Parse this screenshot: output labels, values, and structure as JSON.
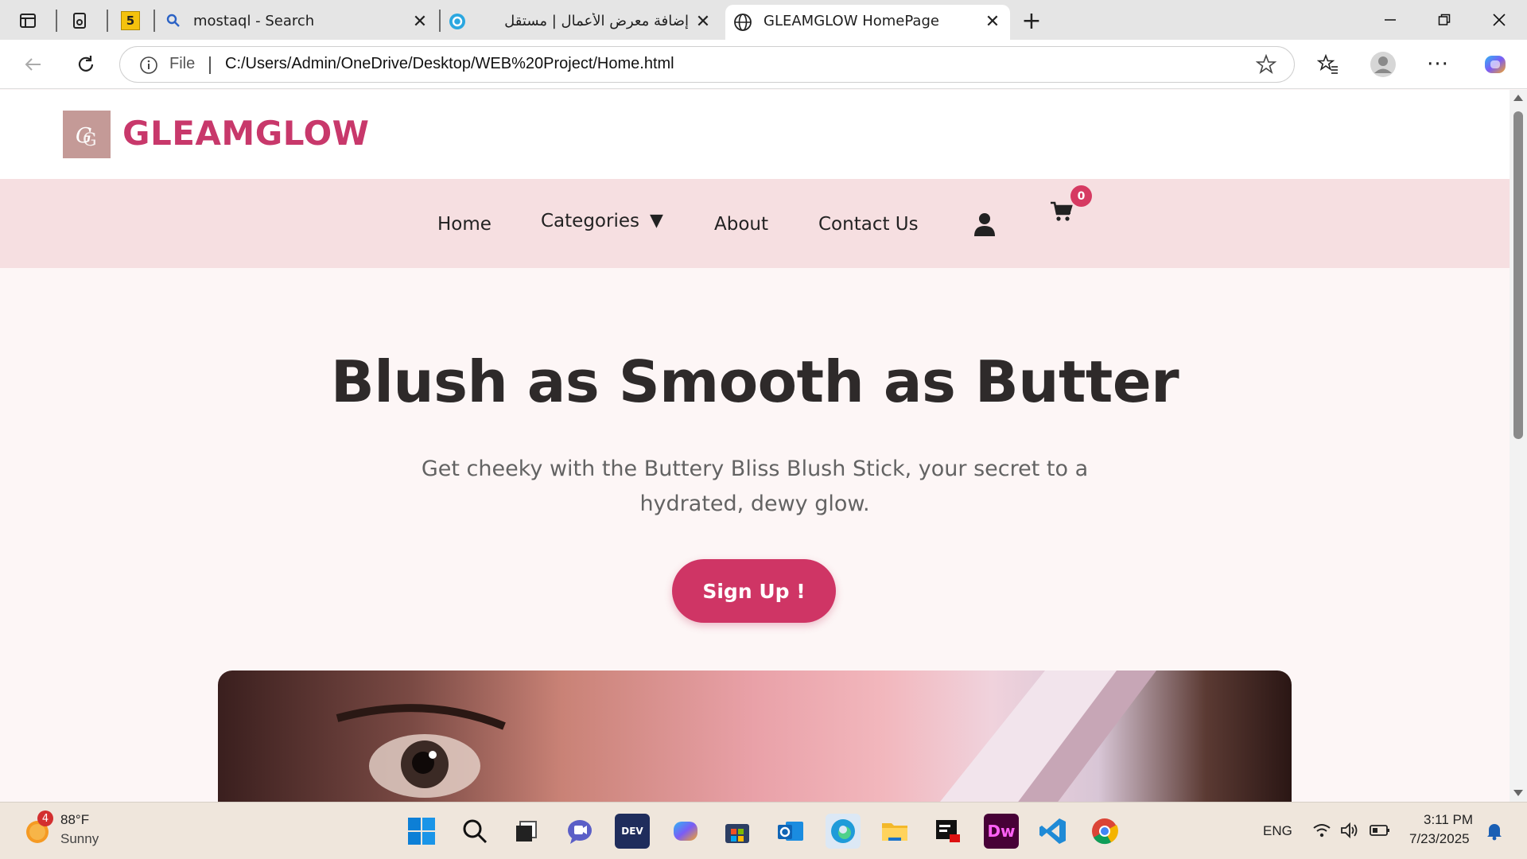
{
  "browser": {
    "tabs": [
      {
        "title": "mostaql - Search"
      },
      {
        "title": "إضافة معرض الأعمال | مستقل"
      },
      {
        "title": "GLEAMGLOW HomePage",
        "active": true
      }
    ],
    "workspace_badge": "5",
    "address": {
      "scheme_label": "File",
      "url": "C:/Users/Admin/OneDrive/Desktop/WEB%20Project/Home.html"
    }
  },
  "site": {
    "logo_text": "GLEAMGLOW",
    "nav": {
      "home": "Home",
      "categories": "Categories",
      "categories_caret": "▼",
      "about": "About",
      "contact": "Contact Us",
      "cart_count": "0"
    },
    "hero": {
      "title": "Blush as Smooth as Butter",
      "subtitle": "Get cheeky with the Buttery Bliss Blush Stick, your secret to a hydrated, dewy glow.",
      "cta": "Sign Up !"
    }
  },
  "taskbar": {
    "weather": {
      "temp": "88°F",
      "desc": "Sunny",
      "badge": "4"
    },
    "lang": "ENG",
    "time": "3:11 PM",
    "date": "7/23/2025"
  },
  "colors": {
    "brand": "#c8386b",
    "cta": "#cf3565",
    "nav_bg": "#f6dfe1",
    "page_bg": "#fdf6f6"
  }
}
